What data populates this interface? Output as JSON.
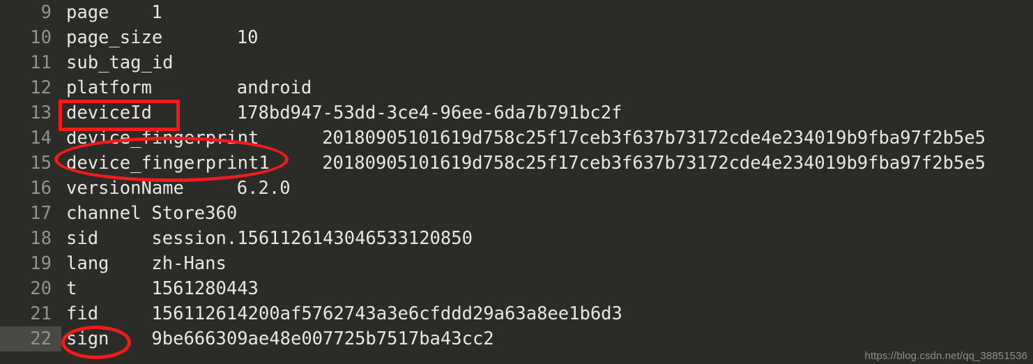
{
  "editor": {
    "background_color": "#2b2b28",
    "text_color": "#e9e7df",
    "gutter_text_color": "#909490",
    "active_line_highlight_color": "#4a4a45",
    "annotation_color": "#f41a1a",
    "active_line_number": "22",
    "lines": [
      {
        "number": "9",
        "text": "page\t1"
      },
      {
        "number": "10",
        "text": "page_size\t10"
      },
      {
        "number": "11",
        "text": "sub_tag_id"
      },
      {
        "number": "12",
        "text": "platform\tandroid"
      },
      {
        "number": "13",
        "text": "deviceId\t178bd947-53dd-3ce4-96ee-6da7b791bc2f"
      },
      {
        "number": "14",
        "text": "device_fingerprint\t20180905101619d758c25f17ceb3f637b73172cde4e234019b9fba97f2b5e5"
      },
      {
        "number": "15",
        "text": "device_fingerprint1\t20180905101619d758c25f17ceb3f637b73172cde4e234019b9fba97f2b5e5"
      },
      {
        "number": "16",
        "text": "versionName\t6.2.0"
      },
      {
        "number": "17",
        "text": "channel\tStore360"
      },
      {
        "number": "18",
        "text": "sid\tsession.1561126143046533120850"
      },
      {
        "number": "19",
        "text": "lang\tzh-Hans"
      },
      {
        "number": "20",
        "text": "t\t1561280443"
      },
      {
        "number": "21",
        "text": "fid\t156112614200af5762743a3e6cfddd29a63a8ee1b6d3"
      },
      {
        "number": "22",
        "text": "sign\t9be666309ae48e007725b7517ba43cc2"
      }
    ],
    "entries": [
      {
        "key": "page",
        "value": "1"
      },
      {
        "key": "page_size",
        "value": "10"
      },
      {
        "key": "sub_tag_id",
        "value": ""
      },
      {
        "key": "platform",
        "value": "android"
      },
      {
        "key": "deviceId",
        "value": "178bd947-53dd-3ce4-96ee-6da7b791bc2f"
      },
      {
        "key": "device_fingerprint",
        "value": "20180905101619d758c25f17ceb3f637b73172cde4e234019b9fba97f2b5e5"
      },
      {
        "key": "device_fingerprint1",
        "value": "20180905101619d758c25f17ceb3f637b73172cde4e234019b9fba97f2b5e5"
      },
      {
        "key": "versionName",
        "value": "6.2.0"
      },
      {
        "key": "channel",
        "value": "Store360"
      },
      {
        "key": "sid",
        "value": "session.1561126143046533120850"
      },
      {
        "key": "lang",
        "value": "zh-Hans"
      },
      {
        "key": "t",
        "value": "1561280443"
      },
      {
        "key": "fid",
        "value": "156112614200af5762743a3e6cfddd29a63a8ee1b6d3"
      },
      {
        "key": "sign",
        "value": "9be666309ae48e007725b7517ba43cc2"
      }
    ]
  },
  "annotations": [
    {
      "shape": "rectangle",
      "target": "deviceId"
    },
    {
      "shape": "ellipse",
      "target": "device_fingerprint / device_fingerprint1"
    },
    {
      "shape": "ellipse",
      "target": "sign"
    }
  ],
  "watermark": {
    "text": "https://blog.csdn.net/qq_38851536"
  }
}
